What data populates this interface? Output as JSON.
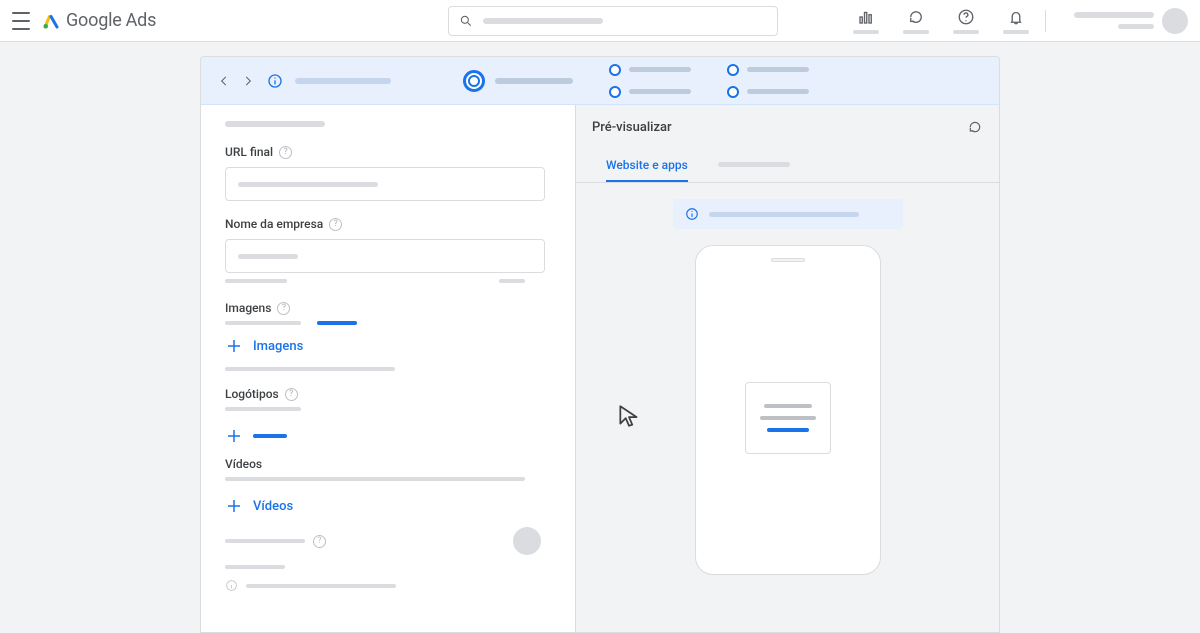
{
  "brand": {
    "name": "Google",
    "product": "Ads"
  },
  "form": {
    "url_label": "URL final",
    "company_label": "Nome da empresa",
    "images_label": "Imagens",
    "images_add": "Imagens",
    "logos_label": "Logótipos",
    "videos_label": "Vídeos",
    "videos_add": "Vídeos"
  },
  "preview": {
    "title": "Pré-visualizar",
    "tab_active": "Website e apps"
  },
  "colors": {
    "primary": "#1a73e8",
    "surface": "#ffffff",
    "bg": "#f1f3f4"
  }
}
